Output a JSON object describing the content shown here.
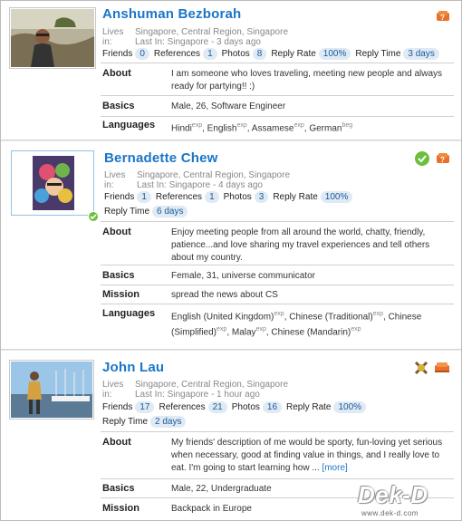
{
  "profiles": [
    {
      "name": "Anshuman Bezborah",
      "lives_label": "Lives in:",
      "lives": "Singapore, Central Region, Singapore",
      "last_in": "Last In: Singapore - 3 days ago",
      "stats": {
        "friends_label": "Friends",
        "friends": "0",
        "references_label": "References",
        "references": "1",
        "photos_label": "Photos",
        "photos": "8",
        "reply_rate_label": "Reply Rate",
        "reply_rate": "100%",
        "reply_time_label": "Reply Time",
        "reply_time": "3 days"
      },
      "about_label": "About",
      "about": "I am someone who loves traveling, meeting new people and always ready for partying!! :)",
      "basics_label": "Basics",
      "basics": "Male, 26, Software Engineer",
      "languages_label": "Languages",
      "languages": [
        {
          "name": "Hindi",
          "level": "exp"
        },
        {
          "name": "English",
          "level": "exp"
        },
        {
          "name": "Assamese",
          "level": "exp"
        },
        {
          "name": "German",
          "level": "beg"
        }
      ],
      "icons": [
        "couch-unavailable-icon"
      ]
    },
    {
      "name": "Bernadette Chew",
      "lives_label": "Lives in:",
      "lives": "Singapore, Central Region, Singapore",
      "last_in": "Last In: Singapore - 4 days ago",
      "stats": {
        "friends_label": "Friends",
        "friends": "1",
        "references_label": "References",
        "references": "1",
        "photos_label": "Photos",
        "photos": "3",
        "reply_rate_label": "Reply Rate",
        "reply_rate": "100%",
        "reply_time_label": "Reply Time",
        "reply_time": "6 days"
      },
      "about_label": "About",
      "about": "Enjoy meeting people from all around the world, chatty, friendly, patience...and love sharing my travel experiences and tell others about my country.",
      "basics_label": "Basics",
      "basics": "Female, 31, universe communicator",
      "mission_label": "Mission",
      "mission": "spread the news about CS",
      "languages_label": "Languages",
      "languages": [
        {
          "name": "English (United Kingdom)",
          "level": "exp"
        },
        {
          "name": "Chinese (Traditional)",
          "level": "exp"
        },
        {
          "name": "Chinese (Simplified)",
          "level": "exp"
        },
        {
          "name": "Malay",
          "level": "exp"
        },
        {
          "name": "Chinese (Mandarin)",
          "level": "exp"
        }
      ],
      "icons": [
        "verified-check-icon",
        "couch-unavailable-icon"
      ]
    },
    {
      "name": "John Lau",
      "lives_label": "Lives in:",
      "lives": "Singapore, Central Region, Singapore",
      "last_in": "Last In: Singapore - 1 hour ago",
      "stats": {
        "friends_label": "Friends",
        "friends": "17",
        "references_label": "References",
        "references": "21",
        "photos_label": "Photos",
        "photos": "16",
        "reply_rate_label": "Reply Rate",
        "reply_rate": "100%",
        "reply_time_label": "Reply Time",
        "reply_time": "2 days"
      },
      "about_label": "About",
      "about": "My friends' description of me would be sporty, fun-loving yet serious when necessary, good at finding value in things, and I really love to eat. I'm going to start learning how ...",
      "more_label": "[more]",
      "basics_label": "Basics",
      "basics": "Male, 22, Undergraduate",
      "mission_label": "Mission",
      "mission": "Backpack in Europe",
      "icons": [
        "ambassador-icon",
        "couch-available-icon"
      ]
    }
  ],
  "watermark": {
    "brand": "Dek-D",
    "url": "www.dek-d.com"
  }
}
